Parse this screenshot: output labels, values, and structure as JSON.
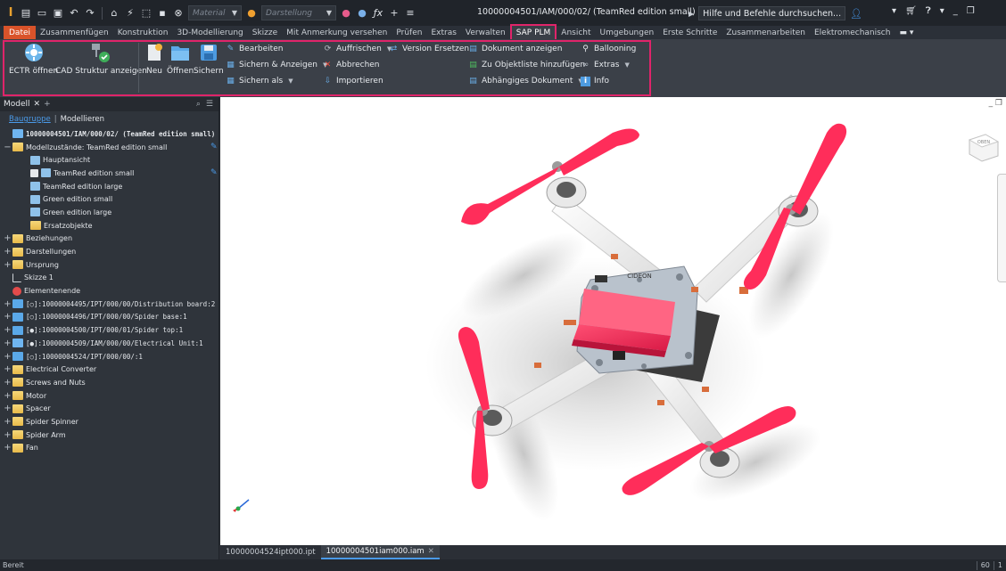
{
  "titlebar": {
    "logo": "I",
    "material_placeholder": "Material",
    "appearance_placeholder": "Darstellung",
    "title": "10000004501/IAM/000/02/ (TeamRed edition small)",
    "help_search": "Hilfe und Befehle durchsuchen..."
  },
  "tabs": [
    "Datei",
    "Zusammenfügen",
    "Konstruktion",
    "3D-Modellierung",
    "Skizze",
    "Mit Anmerkung versehen",
    "Prüfen",
    "Extras",
    "Verwalten",
    "SAP PLM",
    "Ansicht",
    "Umgebungen",
    "Erste Schritte",
    "Zusammenarbeiten",
    "Elektromechanisch"
  ],
  "ribbon": {
    "ectr_open": "ECTR öffnen",
    "cad_structure": "CAD Struktur anzeigen",
    "new": "Neu",
    "open": "Öffnen",
    "save": "Sichern",
    "edit": "Bearbeiten",
    "save_show": "Sichern & Anzeigen",
    "save_as": "Sichern als",
    "refresh": "Auffrischen",
    "replace_version": "Version Ersetzen",
    "cancel": "Abbrechen",
    "import": "Importieren",
    "show_document": "Dokument anzeigen",
    "add_to_objectlist": "Zu Objektliste hinzufügen",
    "dependent_document": "Abhängiges Dokument",
    "ballooning": "Ballooning",
    "extras": "Extras",
    "info": "Info"
  },
  "browser": {
    "tab_label": "Modell",
    "sub_link": "Baugruppe",
    "sub_other": "Modellieren",
    "rows": [
      {
        "indent": 0,
        "exp": "",
        "icon": "asm",
        "text": "10000004501/IAM/000/02/ (TeamRed edition small)",
        "top": true,
        "mono": true
      },
      {
        "indent": 0,
        "exp": "−",
        "icon": "folder",
        "text": "Modellzustände: TeamRed edition small",
        "pen": true
      },
      {
        "indent": 2,
        "exp": "",
        "icon": "view",
        "text": "Hauptansicht"
      },
      {
        "indent": 2,
        "exp": "",
        "icon": "view",
        "text": "TeamRed edition small",
        "check": true,
        "pen": true
      },
      {
        "indent": 2,
        "exp": "",
        "icon": "view",
        "text": "TeamRed edition large"
      },
      {
        "indent": 2,
        "exp": "",
        "icon": "view",
        "text": "Green edition small"
      },
      {
        "indent": 2,
        "exp": "",
        "icon": "view",
        "text": "Green edition large"
      },
      {
        "indent": 2,
        "exp": "",
        "icon": "folder",
        "text": "Ersatzobjekte"
      },
      {
        "indent": 0,
        "exp": "+",
        "icon": "folder",
        "text": "Beziehungen"
      },
      {
        "indent": 0,
        "exp": "+",
        "icon": "folder",
        "text": "Darstellungen"
      },
      {
        "indent": 0,
        "exp": "+",
        "icon": "folder",
        "text": "Ursprung"
      },
      {
        "indent": 0,
        "exp": "",
        "icon": "sketch",
        "text": "Skizze 1"
      },
      {
        "indent": 0,
        "exp": "",
        "icon": "end",
        "text": "Elementenende"
      },
      {
        "indent": 0,
        "exp": "+",
        "icon": "part",
        "text": "[○]:10000004495/IPT/000/00/Distribution board:2",
        "mono": true
      },
      {
        "indent": 0,
        "exp": "+",
        "icon": "part",
        "text": "[○]:10000004496/IPT/000/00/Spider base:1",
        "mono": true
      },
      {
        "indent": 0,
        "exp": "+",
        "icon": "part",
        "text": "[●]:10000004500/IPT/000/01/Spider top:1",
        "mono": true
      },
      {
        "indent": 0,
        "exp": "+",
        "icon": "asm",
        "text": "[●]:10000004509/IAM/000/00/Electrical Unit:1",
        "mono": true
      },
      {
        "indent": 0,
        "exp": "+",
        "icon": "part",
        "text": "[○]:10000004524/IPT/000/00/:1",
        "mono": true
      },
      {
        "indent": 0,
        "exp": "+",
        "icon": "folder",
        "text": "Electrical Converter"
      },
      {
        "indent": 0,
        "exp": "+",
        "icon": "folder",
        "text": "Screws and Nuts"
      },
      {
        "indent": 0,
        "exp": "+",
        "icon": "folder",
        "text": "Motor"
      },
      {
        "indent": 0,
        "exp": "+",
        "icon": "folder",
        "text": "Spacer"
      },
      {
        "indent": 0,
        "exp": "+",
        "icon": "folder",
        "text": "Spider Spinner"
      },
      {
        "indent": 0,
        "exp": "+",
        "icon": "folder",
        "text": "Spider Arm"
      },
      {
        "indent": 0,
        "exp": "+",
        "icon": "folder",
        "text": "Fan"
      }
    ]
  },
  "viewport": {
    "viewcube_face": "OBEN",
    "board_label": "CIDEON",
    "accent_red": "#ff2d5a"
  },
  "doctabs": [
    {
      "label": "10000004524ipt000.ipt",
      "active": false
    },
    {
      "label": "10000004501iam000.iam",
      "active": true
    }
  ],
  "status": {
    "text": "Bereit",
    "count1": "60",
    "count2": "1"
  }
}
